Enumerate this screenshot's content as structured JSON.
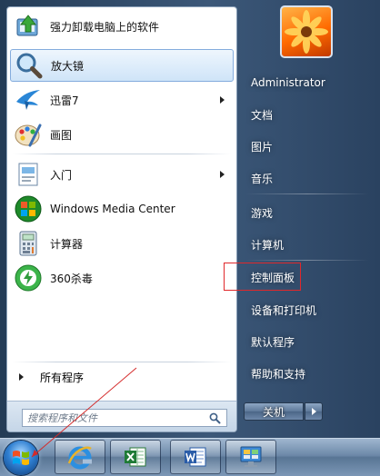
{
  "programs": [
    {
      "label": "强力卸载电脑上的软件",
      "icon": "uninstall-icon",
      "has_submenu": false,
      "selected": false
    },
    {
      "label": "放大镜",
      "icon": "magnifier-icon",
      "has_submenu": false,
      "selected": true
    },
    {
      "label": "迅雷7",
      "icon": "thunder-icon",
      "has_submenu": true,
      "selected": false
    },
    {
      "label": "画图",
      "icon": "paint-icon",
      "has_submenu": false,
      "selected": false
    },
    {
      "label": "入门",
      "icon": "getting-started-icon",
      "has_submenu": true,
      "selected": false
    },
    {
      "label": "Windows Media Center",
      "icon": "media-center-icon",
      "has_submenu": false,
      "selected": false
    },
    {
      "label": "计算器",
      "icon": "calculator-icon",
      "has_submenu": false,
      "selected": false
    },
    {
      "label": "360杀毒",
      "icon": "antivirus-360-icon",
      "has_submenu": false,
      "selected": false
    }
  ],
  "all_programs": {
    "label": "所有程序"
  },
  "search": {
    "placeholder": "搜索程序和文件"
  },
  "right_items": [
    "Administrator",
    "文档",
    "图片",
    "音乐",
    "游戏",
    "计算机",
    "控制面板",
    "设备和打印机",
    "默认程序",
    "帮助和支持"
  ],
  "shutdown": {
    "label": "关机"
  },
  "taskbar": {
    "items": [
      {
        "icon": "internet-explorer-icon"
      },
      {
        "icon": "excel-icon"
      },
      {
        "icon": "word-icon"
      },
      {
        "icon": "control-panel-icon"
      }
    ]
  },
  "colors": {
    "highlight_box": "#e0282b",
    "annotation_arrow": "#d42a2a",
    "selected_item": "#cfe4f8"
  }
}
